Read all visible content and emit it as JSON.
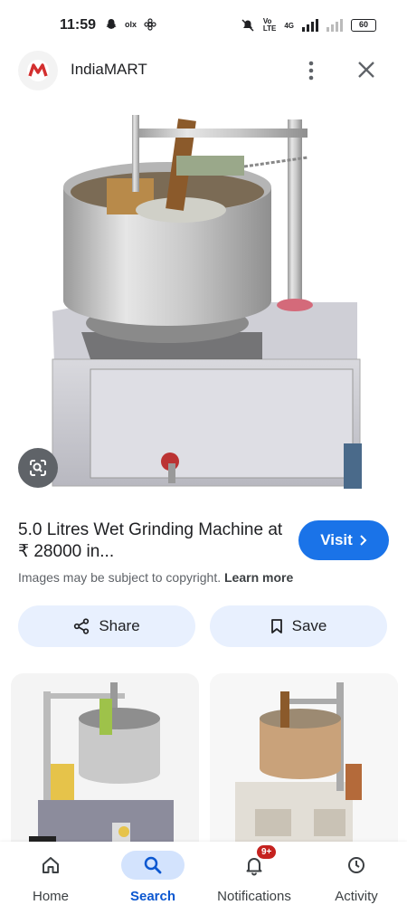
{
  "status_bar": {
    "time": "11:59",
    "battery": "60",
    "network_label": "4G"
  },
  "header": {
    "site_name": "IndiaMART"
  },
  "result": {
    "title": "5.0 Litres Wet Grinding Machine at ₹ 28000 in...",
    "visit_label": "Visit",
    "copyright_text": "Images may be subject to copyright.",
    "learn_more_label": "Learn more",
    "share_label": "Share",
    "save_label": "Save"
  },
  "watermark": "olx",
  "bottom_nav": {
    "items": [
      {
        "label": "Home",
        "icon": "home-icon"
      },
      {
        "label": "Search",
        "icon": "search-icon"
      },
      {
        "label": "Notifications",
        "icon": "bell-icon",
        "badge": "9+"
      },
      {
        "label": "Activity",
        "icon": "activity-icon"
      }
    ]
  },
  "colors": {
    "accent": "#1a73e8",
    "action_bg": "#e8f0fe",
    "badge": "#c5221f"
  }
}
